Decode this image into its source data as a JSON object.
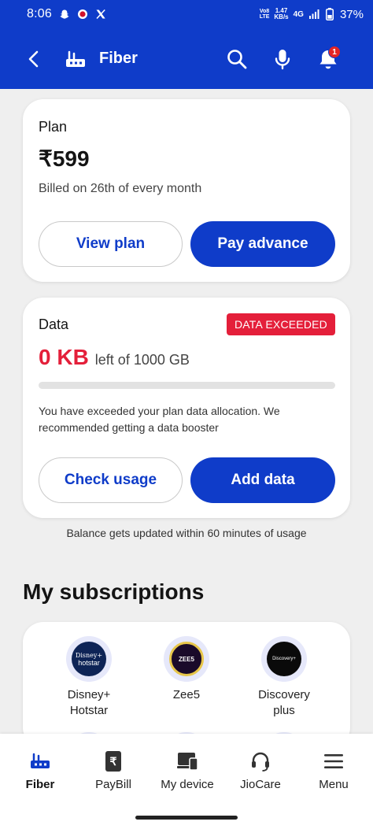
{
  "status_bar": {
    "time": "8:06",
    "volte_top": "Vo8",
    "volte_bottom": "LTE",
    "speed_value": "1.47",
    "speed_unit": "KB/s",
    "network": "4G",
    "battery": "37%"
  },
  "header": {
    "title": "Fiber",
    "notification_count": "1"
  },
  "plan": {
    "title": "Plan",
    "price": "₹599",
    "billed": "Billed on 26th of every month",
    "view_plan_label": "View plan",
    "pay_advance_label": "Pay advance"
  },
  "data": {
    "title": "Data",
    "badge": "DATA EXCEEDED",
    "remaining": "0 KB",
    "left_of": "left of 1000 GB",
    "used_fraction": 0,
    "message": "You have exceeded your plan data allocation. We recommended getting a data booster",
    "check_usage_label": "Check usage",
    "add_data_label": "Add data",
    "balance_note": "Balance gets updated within 60 minutes of usage"
  },
  "subscriptions": {
    "heading": "My subscriptions",
    "items": [
      {
        "name": "Disney+ Hotstar",
        "logo_text_top": "Disney+",
        "logo_text_bottom": "hotstar",
        "logo_color": "#0e2456"
      },
      {
        "name": "Zee5",
        "logo_text_top": "ZEE5",
        "logo_text_bottom": "",
        "logo_color": "#1a0a2a"
      },
      {
        "name": "Discovery plus",
        "logo_text_top": "Discovery+",
        "logo_text_bottom": "",
        "logo_color": "#0a0a0a"
      }
    ]
  },
  "nav": {
    "items": [
      {
        "label": "Fiber",
        "icon": "router-icon",
        "active": true
      },
      {
        "label": "PayBill",
        "icon": "bill-icon",
        "active": false
      },
      {
        "label": "My device",
        "icon": "device-icon",
        "active": false
      },
      {
        "label": "JioCare",
        "icon": "headset-icon",
        "active": false
      },
      {
        "label": "Menu",
        "icon": "menu-icon",
        "active": false
      }
    ]
  },
  "colors": {
    "brand_blue": "#0f3cc9",
    "alert_red": "#e41f3a"
  }
}
